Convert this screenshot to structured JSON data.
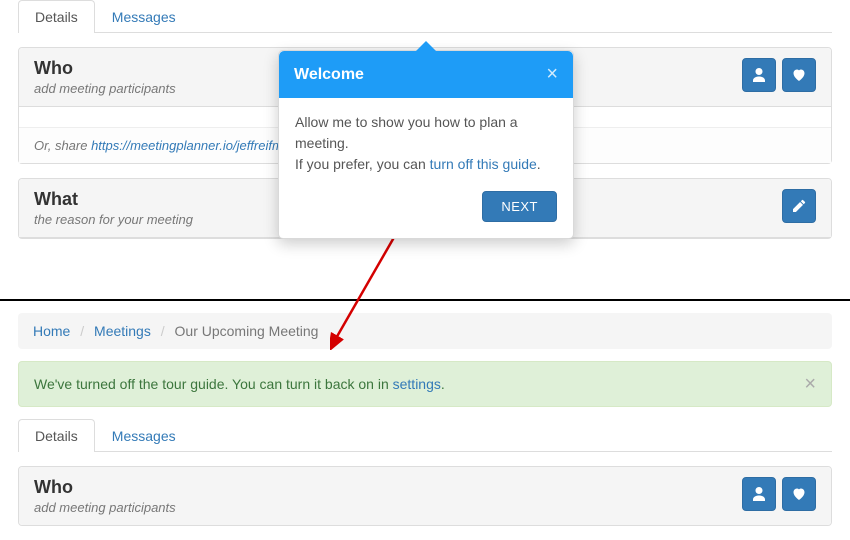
{
  "tabs1": {
    "details": "Details",
    "messages": "Messages"
  },
  "who": {
    "title": "Who",
    "sub": "add meeting participants",
    "share_prefix": "Or, share ",
    "share_url": "https://meetingplanner.io/jeffreifman/4Idx"
  },
  "what": {
    "title": "What",
    "sub": "the reason for your meeting"
  },
  "popover": {
    "title": "Welcome",
    "line1": "Allow me to show you how to plan a meeting.",
    "line2a": "If you prefer, you can ",
    "line2_link": "turn off this guide",
    "line2b": ".",
    "next": "NEXT",
    "close": "×"
  },
  "breadcrumbs": {
    "home": "Home",
    "meetings": "Meetings",
    "current": "Our Upcoming Meeting",
    "sep": "/"
  },
  "alert": {
    "text1": "We've turned off the tour guide. You can turn it back on in ",
    "link": "settings",
    "text2": ".",
    "close": "×"
  },
  "tabs2": {
    "details": "Details",
    "messages": "Messages"
  },
  "who2": {
    "title": "Who",
    "sub": "add meeting participants"
  }
}
